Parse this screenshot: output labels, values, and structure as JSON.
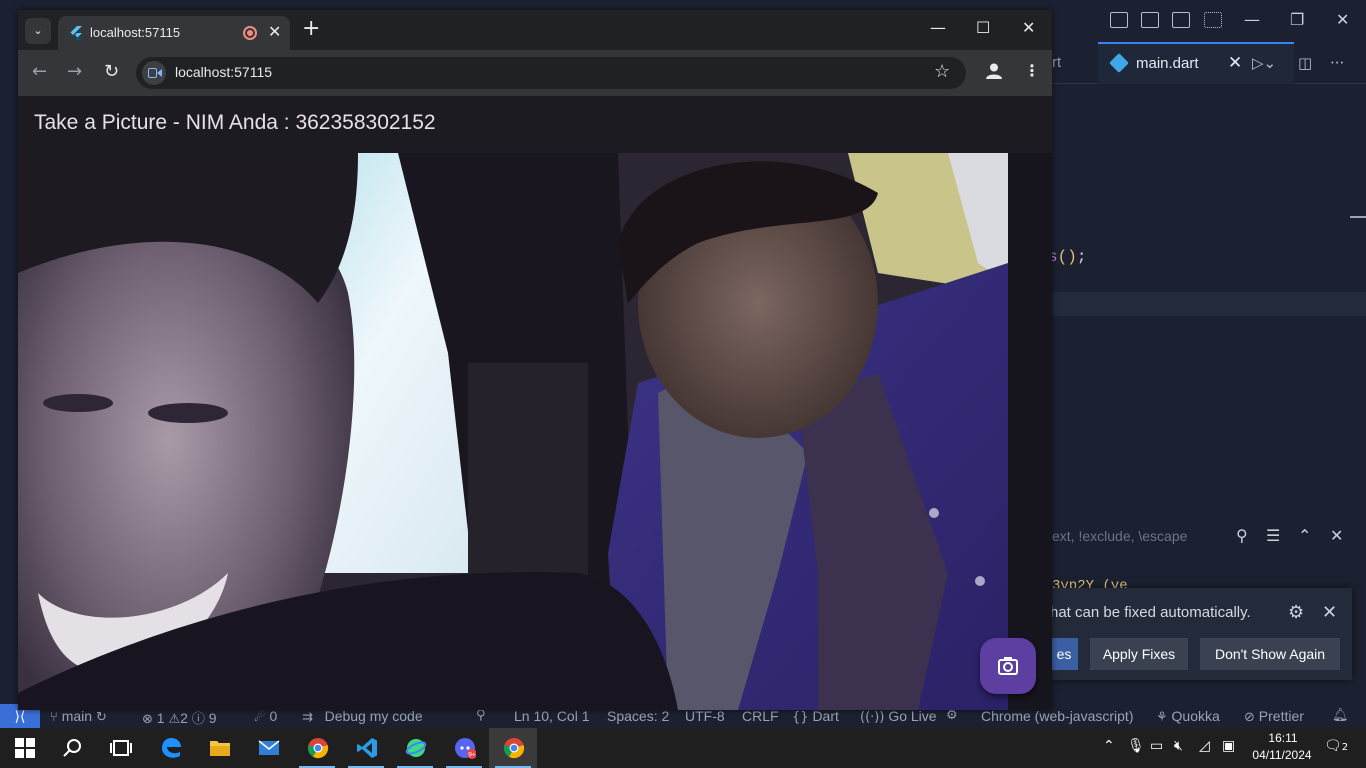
{
  "chrome": {
    "tab_title": "localhost:57115",
    "url": "localhost:57115"
  },
  "app": {
    "title": "Take a Picture - NIM Anda : 362358302152",
    "capture_icon": "camera-icon"
  },
  "vscode": {
    "active_tab": "main.dart",
    "prev_tab_fragment": "rt",
    "code_fragment": {
      "a": "s",
      "b": "()",
      "c": ";"
    },
    "find_placeholder": "ext, !exclude, \\escape",
    "partial_code": "3yp2Y (ye",
    "notification": {
      "message": "hat can be fixed automatically.",
      "fix_all_label": "es",
      "apply_fixes_label": "Apply Fixes",
      "dont_show_label": "Don't Show Again"
    },
    "status": {
      "branch": "main",
      "errors": "1",
      "warnings": "2",
      "infos": "9",
      "ports": "0",
      "debug": "Debug my code",
      "position": "Ln 10, Col 1",
      "spaces": "Spaces: 2",
      "encoding": "UTF-8",
      "eol": "CRLF",
      "language": "Dart",
      "golive": "Go Live",
      "device": "Chrome (web-javascript)",
      "quokka": "Quokka",
      "prettier": "Prettier"
    }
  },
  "taskbar": {
    "time": "16:11",
    "date": "04/11/2024",
    "notification_count": "2",
    "badge": "9+"
  },
  "colors": {
    "app_bar": "#1d1b22",
    "fab": "#5c3fa0",
    "vscode_accent": "#3b6fd8",
    "chrome_toolbar": "#35363a"
  }
}
